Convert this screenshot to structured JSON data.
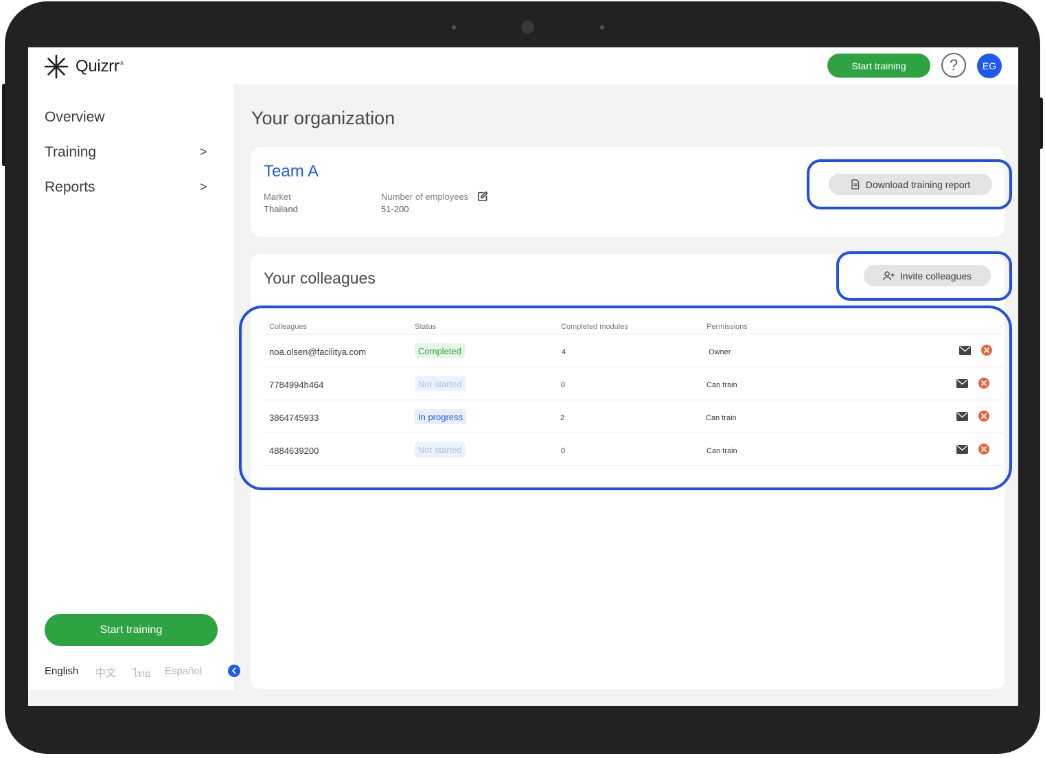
{
  "brand": {
    "name": "Quizrr",
    "reg": "®"
  },
  "header": {
    "start_training": "Start training",
    "help": "?",
    "avatar": "EG"
  },
  "sidebar": {
    "items": [
      {
        "label": "Overview"
      },
      {
        "label": "Training",
        "chevron": ">"
      },
      {
        "label": "Reports",
        "chevron": ">"
      }
    ],
    "start_training": "Start training",
    "languages": [
      "English",
      "中文",
      "ไทย",
      "Español"
    ],
    "active_language": "English"
  },
  "page": {
    "title": "Your organization"
  },
  "org": {
    "team_name": "Team A",
    "market_label": "Market",
    "market_value": "Thailand",
    "employees_label": "Number of employees",
    "employees_value": "51-200",
    "download_label": "Download training report"
  },
  "colleagues": {
    "title": "Your colleagues",
    "invite_label": "Invite colleagues",
    "columns": [
      "Colleagues",
      "Status",
      "Completed modules",
      "Permissions"
    ],
    "rows": [
      {
        "name": "noa.olsen@facilitya.com",
        "status": "Completed",
        "status_type": "completed",
        "modules": "4",
        "permission": "Owner"
      },
      {
        "name": "7784994h464",
        "status": "Not started",
        "status_type": "notstarted",
        "modules": "0",
        "permission": "Can train"
      },
      {
        "name": "3864745933",
        "status": "In progress",
        "status_type": "inprogress",
        "modules": "2",
        "permission": "Can train"
      },
      {
        "name": "4884639200",
        "status": "Not started",
        "status_type": "notstarted",
        "modules": "0",
        "permission": "Can train"
      }
    ]
  },
  "colors": {
    "accent_blue": "#1f5af0",
    "green": "#2ea342",
    "danger": "#e8643c",
    "highlight": "#1f4fe8"
  }
}
